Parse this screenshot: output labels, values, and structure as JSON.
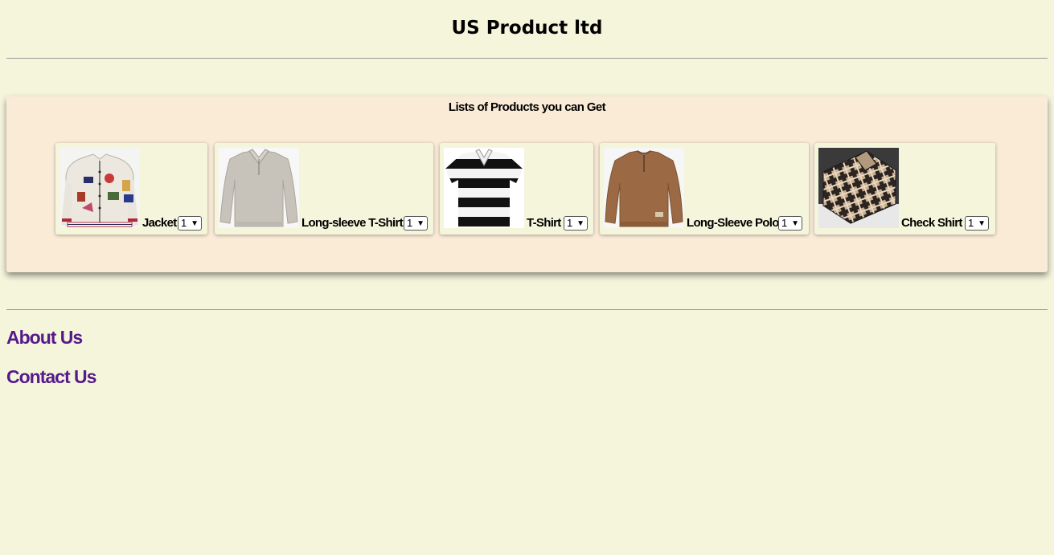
{
  "header": {
    "title": "US Product ltd"
  },
  "products_panel": {
    "title": "Lists of Products you can Get",
    "items": [
      {
        "label": "Jacket",
        "quantity": "1",
        "image": "varsity-jacket-image"
      },
      {
        "label": "Long-sleeve T-Shirt",
        "quantity": "1",
        "image": "grey-sweater-image"
      },
      {
        "label": "T-Shirt",
        "quantity": "1",
        "image": "striped-polo-image"
      },
      {
        "label": "Long-Sleeve Polo",
        "quantity": "1",
        "image": "brown-polo-image"
      },
      {
        "label": "Check Shirt",
        "quantity": "1",
        "image": "plaid-shirt-image"
      }
    ]
  },
  "footer": {
    "about_label": "About Us",
    "contact_label": "Contact Us"
  },
  "colors": {
    "background": "#f5f5dc",
    "panel_background": "#faebd7",
    "link": "#551a8b"
  }
}
